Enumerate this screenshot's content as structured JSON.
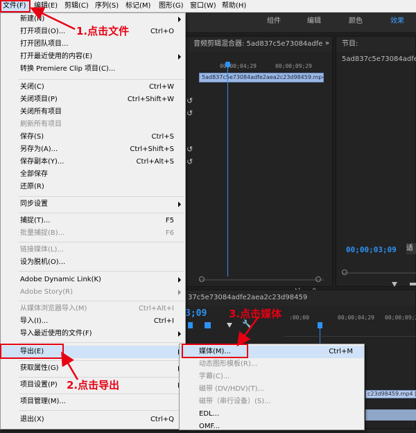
{
  "menubar": {
    "items": [
      "文件(F)",
      "编辑(E)",
      "剪辑(C)",
      "序列(S)",
      "标记(M)",
      "图形(G)",
      "窗口(W)",
      "帮助(H)"
    ]
  },
  "workspace_tabs": [
    "组件",
    "编辑",
    "颜色",
    "效果"
  ],
  "audio_mixer": {
    "title": "音频剪辑混合器: 5ad837c5e73084adfe",
    "timecodes": [
      "00;00;04;29",
      "00;00;09;29"
    ],
    "clip_name": "5ad837c5e73084adfe2aea2c23d98459.mp4"
  },
  "program_monitor": {
    "title": "节目: 5ad837c5e73084adfe",
    "timecode": "00;00;03;09",
    "fit_label": "适"
  },
  "timeline": {
    "title": "37c5e73084adfe2aea2c23d98459",
    "timecode": "3;09",
    "ruler": [
      ":00;00",
      "00;00;04;29",
      "00;00;09;29"
    ],
    "clip_name": "c23d98459.mp4 [V] [~"
  },
  "file_menu": {
    "items": [
      {
        "label": "新建(N)",
        "shortcut": "",
        "submenu": true,
        "disabled": false
      },
      {
        "label": "打开项目(O)...",
        "shortcut": "Ctrl+O",
        "submenu": false,
        "disabled": false
      },
      {
        "label": "打开团队项目...",
        "shortcut": "",
        "submenu": false,
        "disabled": false
      },
      {
        "label": "打开最近使用的内容(E)",
        "shortcut": "",
        "submenu": true,
        "disabled": false
      },
      {
        "label": "转换 Premiere Clip 项目(C)...",
        "shortcut": "",
        "submenu": false,
        "disabled": false
      },
      {
        "label": "关闭(C)",
        "shortcut": "Ctrl+W",
        "submenu": false,
        "disabled": false
      },
      {
        "label": "关闭项目(P)",
        "shortcut": "Ctrl+Shift+W",
        "submenu": false,
        "disabled": false
      },
      {
        "label": "关闭所有项目",
        "shortcut": "",
        "submenu": false,
        "disabled": false
      },
      {
        "label": "刷新所有项目",
        "shortcut": "",
        "submenu": false,
        "disabled": true
      },
      {
        "label": "保存(S)",
        "shortcut": "Ctrl+S",
        "submenu": false,
        "disabled": false
      },
      {
        "label": "另存为(A)...",
        "shortcut": "Ctrl+Shift+S",
        "submenu": false,
        "disabled": false
      },
      {
        "label": "保存副本(Y)...",
        "shortcut": "Ctrl+Alt+S",
        "submenu": false,
        "disabled": false
      },
      {
        "label": "全部保存",
        "shortcut": "",
        "submenu": false,
        "disabled": false
      },
      {
        "label": "还原(R)",
        "shortcut": "",
        "submenu": false,
        "disabled": false
      },
      {
        "label": "同步设置",
        "shortcut": "",
        "submenu": true,
        "disabled": false
      },
      {
        "label": "捕捉(T)...",
        "shortcut": "F5",
        "submenu": false,
        "disabled": false
      },
      {
        "label": "批量捕捉(B)...",
        "shortcut": "F6",
        "submenu": false,
        "disabled": true
      },
      {
        "label": "链接媒体(L)...",
        "shortcut": "",
        "submenu": false,
        "disabled": true
      },
      {
        "label": "设为脱机(O)...",
        "shortcut": "",
        "submenu": false,
        "disabled": false
      },
      {
        "label": "Adobe Dynamic Link(K)",
        "shortcut": "",
        "submenu": true,
        "disabled": false
      },
      {
        "label": "Adobe Story(R)",
        "shortcut": "",
        "submenu": true,
        "disabled": true
      },
      {
        "label": "从媒体浏览器导入(M)",
        "shortcut": "Ctrl+Alt+I",
        "submenu": false,
        "disabled": true
      },
      {
        "label": "导入(I)...",
        "shortcut": "Ctrl+I",
        "submenu": false,
        "disabled": false
      },
      {
        "label": "导入最近使用的文件(F)",
        "shortcut": "",
        "submenu": true,
        "disabled": false
      },
      {
        "label": "导出(E)",
        "shortcut": "",
        "submenu": true,
        "disabled": false
      },
      {
        "label": "获取属性(G)",
        "shortcut": "",
        "submenu": true,
        "disabled": false
      },
      {
        "label": "项目设置(P)",
        "shortcut": "",
        "submenu": true,
        "disabled": false
      },
      {
        "label": "项目管理(M)...",
        "shortcut": "",
        "submenu": false,
        "disabled": false
      },
      {
        "label": "退出(X)",
        "shortcut": "Ctrl+Q",
        "submenu": false,
        "disabled": false
      }
    ]
  },
  "export_menu": {
    "items": [
      {
        "label": "媒体(M)...",
        "shortcut": "Ctrl+M",
        "disabled": false
      },
      {
        "label": "动态图形模板(R)...",
        "shortcut": "",
        "disabled": true
      },
      {
        "label": "字幕(C)...",
        "shortcut": "",
        "disabled": true
      },
      {
        "label": "磁带 (DV/HDV)(T)...",
        "shortcut": "",
        "disabled": true
      },
      {
        "label": "磁带（串行设备）(S)...",
        "shortcut": "",
        "disabled": true
      },
      {
        "label": "EDL...",
        "shortcut": "",
        "disabled": false
      },
      {
        "label": "OMF...",
        "shortcut": "",
        "disabled": false
      }
    ]
  },
  "annotations": {
    "step1": "1.点击文件",
    "step2": "2.点击导出",
    "step3": "3.点击媒体",
    "color": "#e60012"
  },
  "colors": {
    "accent_blue": "#2e92f5",
    "menu_bg": "#f0f0f0",
    "highlight": "#cfe2f7",
    "annotation_red": "#e60012"
  }
}
